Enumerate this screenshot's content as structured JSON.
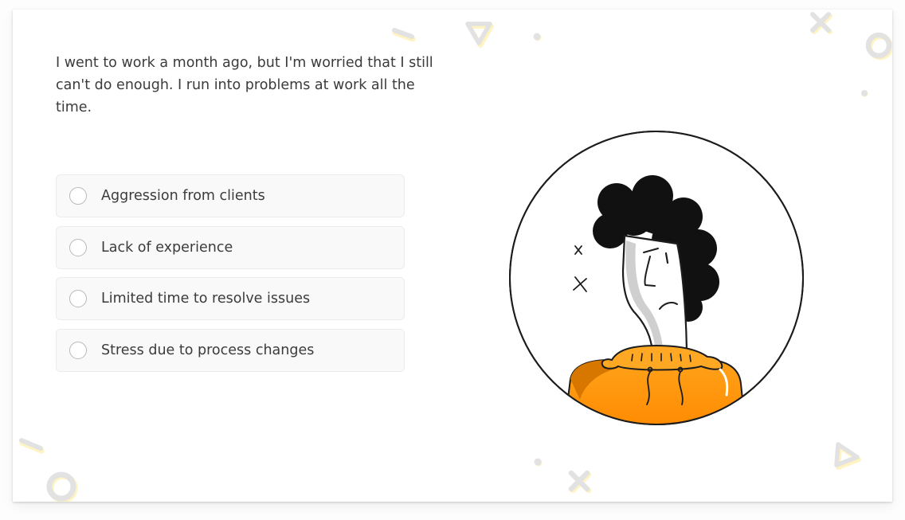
{
  "question": {
    "text": "I went to work a month ago, but I'm worried that I still can't do enough. I run into problems at work all the time."
  },
  "options": [
    {
      "label": "Aggression from clients",
      "selected": false
    },
    {
      "label": "Lack of experience",
      "selected": false
    },
    {
      "label": "Limited time to resolve issues",
      "selected": false
    },
    {
      "label": "Stress due to process changes",
      "selected": false
    }
  ],
  "colors": {
    "decoration": "#e2e2e2",
    "decoration_shadow": "#fff3c2",
    "sweater": "#ff9a0f",
    "sweater_dark": "#e67e00",
    "hair": "#111111"
  }
}
